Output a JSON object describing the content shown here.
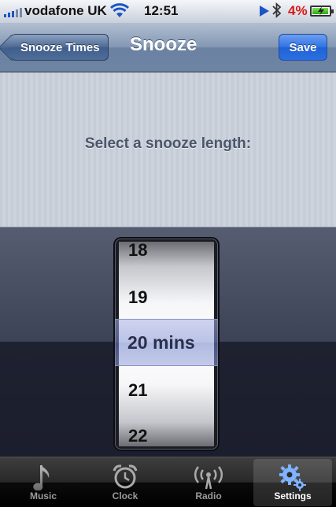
{
  "status_bar": {
    "carrier": "vodafone UK",
    "time": "12:51",
    "battery_percent": "4%",
    "battery_level": 0.04,
    "icons": [
      "signal-icon",
      "wifi-icon",
      "play-icon",
      "bluetooth-icon",
      "battery-charging-icon"
    ]
  },
  "nav": {
    "back_label": "Snooze Times",
    "title": "Snooze",
    "save_label": "Save"
  },
  "content": {
    "prompt": "Select a snooze length:"
  },
  "picker": {
    "rows": [
      "18",
      "19",
      "20 mins",
      "21",
      "22"
    ],
    "selected": "20 mins"
  },
  "tabs": [
    {
      "label": "Music",
      "icon": "music-note-icon",
      "active": false
    },
    {
      "label": "Clock",
      "icon": "alarm-clock-icon",
      "active": false
    },
    {
      "label": "Radio",
      "icon": "radio-antenna-icon",
      "active": false
    },
    {
      "label": "Settings",
      "icon": "gears-icon",
      "active": true
    }
  ],
  "colors": {
    "accent_blue": "#2f72e3",
    "battery_low": "#d81818"
  }
}
